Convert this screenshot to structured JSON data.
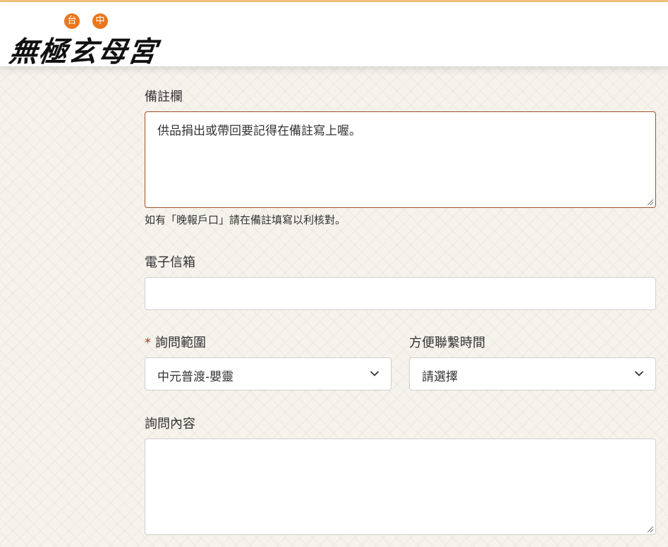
{
  "brand": {
    "badges": [
      "台",
      "中"
    ],
    "name": "無極玄母宮",
    "accent_color": "#e8771e"
  },
  "form": {
    "remarks": {
      "label": "備註欄",
      "value": "供品捐出或帶回要記得在備註寫上喔。",
      "hint": "如有「晚報戶口」請在備註填寫以利核對。"
    },
    "email": {
      "label": "電子信箱",
      "value": ""
    },
    "inquiry_scope": {
      "required_mark": "*",
      "label": "詢問範圍",
      "selected": "中元普渡-嬰靈",
      "icon": "chevron-down-icon"
    },
    "contact_time": {
      "label": "方便聯繫時間",
      "selected": "請選擇",
      "icon": "chevron-down-icon"
    },
    "inquiry_content": {
      "label": "詢問內容",
      "value": ""
    }
  }
}
